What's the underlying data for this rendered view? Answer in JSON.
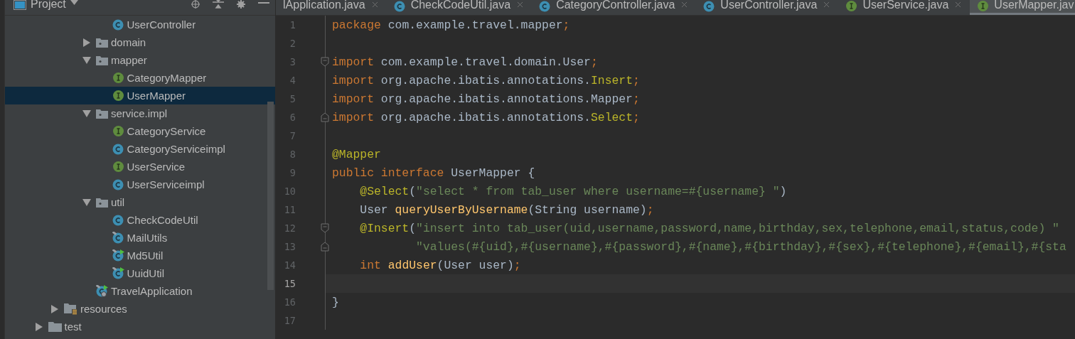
{
  "project_panel": {
    "title": "Project",
    "tree": [
      {
        "children": [
          {
            "children": [
              {
                "children": [
                  {
                    "children": [
                      {
                        "children": [
                          {
                            "label": "UserController",
                            "kind": "class",
                            "selected": false
                          }
                        ]
                      },
                      {
                        "label": "domain",
                        "kind": "package",
                        "expanded": false,
                        "selected": false
                      },
                      {
                        "label": "mapper",
                        "kind": "package",
                        "expanded": true,
                        "selected": false,
                        "children": [
                          {
                            "label": "CategoryMapper",
                            "kind": "interface",
                            "selected": false
                          },
                          {
                            "label": "UserMapper",
                            "kind": "interface",
                            "selected": true
                          }
                        ]
                      },
                      {
                        "label": "service.impl",
                        "kind": "package",
                        "expanded": true,
                        "selected": false,
                        "children": [
                          {
                            "label": "CategoryService",
                            "kind": "interface",
                            "selected": false
                          },
                          {
                            "label": "CategoryServiceimpl",
                            "kind": "class",
                            "selected": false
                          },
                          {
                            "label": "UserService",
                            "kind": "interface",
                            "selected": false
                          },
                          {
                            "label": "UserServiceimpl",
                            "kind": "class",
                            "selected": false
                          }
                        ]
                      },
                      {
                        "label": "util",
                        "kind": "package",
                        "expanded": true,
                        "selected": false,
                        "children": [
                          {
                            "label": "CheckCodeUtil",
                            "kind": "class",
                            "selected": false
                          },
                          {
                            "label": "MailUtils",
                            "kind": "util_class",
                            "selected": false
                          },
                          {
                            "label": "Md5Util",
                            "kind": "runnable_class",
                            "selected": false
                          },
                          {
                            "label": "UuidUtil",
                            "kind": "runnable_class",
                            "selected": false
                          }
                        ]
                      },
                      {
                        "label": "TravelApplication",
                        "kind": "boot_class",
                        "selected": false
                      }
                    ]
                  }
                ]
              },
              {
                "label": "resources",
                "kind": "resources",
                "expanded": false,
                "selected": false
              }
            ]
          },
          {
            "label": "test",
            "kind": "folder",
            "expanded": false,
            "selected": false
          }
        ]
      }
    ]
  },
  "tabs": [
    {
      "label": "lApplication.java",
      "selected": false
    },
    {
      "label": "CheckCodeUtil.java",
      "kind": "class",
      "selected": false
    },
    {
      "label": "CategoryController.java",
      "kind": "class",
      "selected": false
    },
    {
      "label": "UserController.java",
      "kind": "class",
      "selected": false
    },
    {
      "label": "UserService.java",
      "kind": "interface",
      "selected": false
    },
    {
      "label": "UserMapper.jav",
      "kind": "interface",
      "selected": true
    }
  ],
  "code": {
    "lines": [
      {
        "number": "1",
        "current": false,
        "kind": "code",
        "tokens": [
          {
            "kind": "keyword",
            "text": "package "
          },
          {
            "kind": "plain",
            "text": "com.example.travel.mapper"
          },
          {
            "kind": "keyword",
            "text": ";"
          }
        ]
      },
      {
        "number": "2",
        "current": false,
        "kind": "code"
      },
      {
        "number": "3",
        "current": false,
        "kind": "fold_start",
        "tokens": [
          {
            "kind": "keyword",
            "text": "import "
          },
          {
            "kind": "plain",
            "text": "com.example.travel.domain.User"
          },
          {
            "kind": "keyword",
            "text": ";"
          }
        ]
      },
      {
        "number": "4",
        "current": false,
        "kind": "code",
        "tokens": [
          {
            "kind": "keyword",
            "text": "import "
          },
          {
            "kind": "plain",
            "text": "org.apache.ibatis.annotations."
          },
          {
            "kind": "annotation",
            "text": "Insert"
          },
          {
            "kind": "keyword",
            "text": ";"
          }
        ]
      },
      {
        "number": "5",
        "current": false,
        "kind": "code",
        "tokens": [
          {
            "kind": "keyword",
            "text": "import "
          },
          {
            "kind": "plain",
            "text": "org.apache.ibatis.annotations.Mapper"
          },
          {
            "kind": "keyword",
            "text": ";"
          }
        ]
      },
      {
        "number": "6",
        "current": false,
        "kind": "fold_end",
        "tokens": [
          {
            "kind": "keyword",
            "text": "import "
          },
          {
            "kind": "plain",
            "text": "org.apache.ibatis.annotations."
          },
          {
            "kind": "annotation",
            "text": "Select"
          },
          {
            "kind": "keyword",
            "text": ";"
          }
        ]
      },
      {
        "number": "7",
        "current": false,
        "kind": "code"
      },
      {
        "number": "8",
        "current": false,
        "kind": "code",
        "tokens": [
          {
            "kind": "annotation",
            "text": "@Mapper"
          }
        ]
      },
      {
        "number": "9",
        "current": false,
        "kind": "code",
        "tokens": [
          {
            "kind": "keyword",
            "text": "public interface "
          },
          {
            "kind": "plain",
            "text": "UserMapper {"
          }
        ]
      },
      {
        "number": "10",
        "current": false,
        "kind": "code",
        "tokens": [
          {
            "kind": "annotation",
            "text": "    @Select"
          },
          {
            "kind": "plain",
            "text": "("
          },
          {
            "kind": "string",
            "text": "\"select * from tab_user where username=#{username} \""
          },
          {
            "kind": "plain",
            "text": ")"
          }
        ]
      },
      {
        "number": "11",
        "current": false,
        "kind": "code",
        "tokens": [
          {
            "kind": "plain",
            "text": "    User "
          },
          {
            "kind": "method",
            "text": "queryUserByUsername"
          },
          {
            "kind": "plain",
            "text": "(String username)"
          },
          {
            "kind": "keyword",
            "text": ";"
          }
        ]
      },
      {
        "number": "12",
        "current": false,
        "kind": "fold_start",
        "tokens": [
          {
            "kind": "annotation",
            "text": "    @Insert"
          },
          {
            "kind": "plain",
            "text": "("
          },
          {
            "kind": "string",
            "text": "\"insert into tab_user(uid,username,password,name,birthday,sex,telephone,email,status,code) \""
          }
        ]
      },
      {
        "number": "13",
        "current": false,
        "kind": "fold_end",
        "tokens": [
          {
            "kind": "string",
            "text": "            \"values(#{uid},#{username},#{password},#{name},#{birthday},#{sex},#{telephone},#{email},#{sta"
          }
        ]
      },
      {
        "number": "14",
        "current": false,
        "kind": "code",
        "tokens": [
          {
            "kind": "keyword",
            "text": "    int "
          },
          {
            "kind": "method",
            "text": "addUser"
          },
          {
            "kind": "plain",
            "text": "(User user)"
          },
          {
            "kind": "keyword",
            "text": ";"
          }
        ]
      },
      {
        "number": "15",
        "current": true,
        "kind": "code"
      },
      {
        "number": "16",
        "current": false,
        "kind": "code",
        "tokens": [
          {
            "kind": "plain",
            "text": "}"
          }
        ]
      },
      {
        "number": "17",
        "current": false,
        "kind": "code"
      }
    ]
  }
}
